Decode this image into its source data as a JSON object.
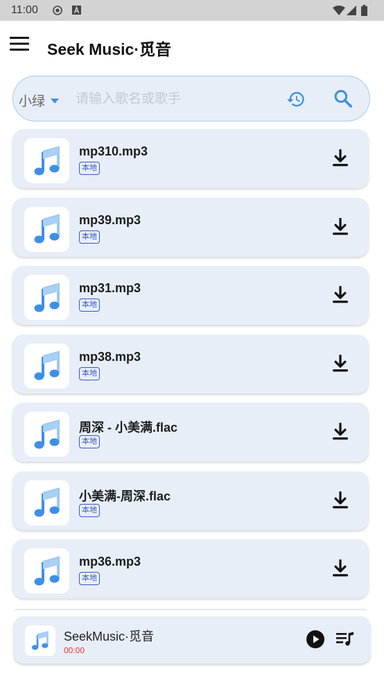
{
  "status_bar": {
    "time": "11:00",
    "icons": [
      "record-icon",
      "a-badge-icon",
      "wifi-icon",
      "signal-icon",
      "battery-icon"
    ]
  },
  "app_bar": {
    "title": "Seek Music·觅音",
    "menu_icon": "hamburger-menu-icon"
  },
  "search": {
    "source": "小绿",
    "placeholder": "请输入歌名或歌手",
    "value": "",
    "history_icon": "history-icon",
    "search_icon": "search-icon"
  },
  "songs": [
    {
      "title": "mp310.mp3",
      "badge": "本地"
    },
    {
      "title": "mp39.mp3",
      "badge": "本地"
    },
    {
      "title": "mp31.mp3",
      "badge": "本地"
    },
    {
      "title": "mp38.mp3",
      "badge": "本地"
    },
    {
      "title": "周深 - 小美满.flac",
      "badge": "本地"
    },
    {
      "title": "小美满-周深.flac",
      "badge": "本地"
    },
    {
      "title": "mp36.mp3",
      "badge": "本地"
    }
  ],
  "player": {
    "title": "SeekMusic·觅音",
    "time": "00:00",
    "play_icon": "play-icon",
    "queue_icon": "playlist-icon"
  },
  "colors": {
    "accent": "#3b8ee0",
    "card_bg": "#e8eef7",
    "badge": "#3a57c4",
    "time_red": "#e53935",
    "status_bar": "#d3d3d3"
  }
}
